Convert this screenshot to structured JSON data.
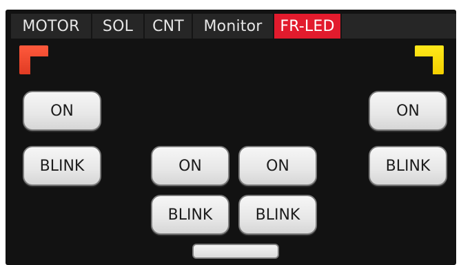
{
  "tabs": [
    "MOTOR",
    "SOL",
    "CNT",
    "Monitor",
    "FR-LED"
  ],
  "active_tab": "FR-LED",
  "indicators": {
    "left_color": "#e8452b",
    "right_color": "#f6dc0a"
  },
  "left_group": {
    "on_label": "ON",
    "blink_label": "BLINK"
  },
  "center_left_group": {
    "on_label": "ON",
    "blink_label": "BLINK"
  },
  "center_right_group": {
    "on_label": "ON",
    "blink_label": "BLINK"
  },
  "right_group": {
    "on_label": "ON",
    "blink_label": "BLINK"
  }
}
